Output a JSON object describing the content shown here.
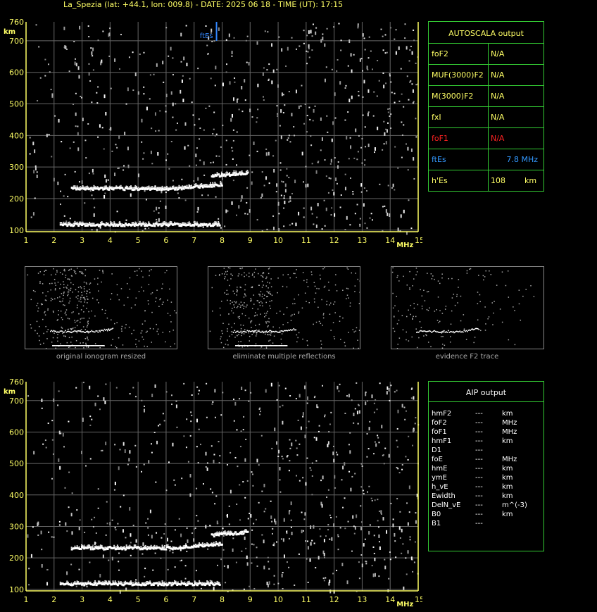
{
  "title": "La_Spezia (lat: +44.1, lon: 009.8) - DATE: 2025 06 18 - TIME (UT): 17:15",
  "colors": {
    "axis": "#ffff66",
    "grid": "#666666",
    "panel_border": "#33cc33",
    "fEs_marker": "#3388ff",
    "foF1": "#ff2222",
    "ftEs": "#3399ff",
    "trace": "#ffffff"
  },
  "chart_data": [
    {
      "type": "scatter",
      "name": "top-ionogram",
      "x_unit": "MHz",
      "y_unit": "km",
      "xlim": [
        1,
        15
      ],
      "ylim": [
        95,
        760
      ],
      "x_ticks": [
        1,
        2,
        3,
        4,
        5,
        6,
        7,
        8,
        9,
        10,
        11,
        12,
        13,
        14,
        15
      ],
      "y_ticks": [
        100,
        200,
        300,
        400,
        500,
        600,
        700,
        760
      ],
      "grid": true,
      "marker_label": "ftEs",
      "marker_x": 7.8,
      "traces": [
        {
          "x_start": 2.2,
          "x_end": 7.9,
          "y": 118
        },
        {
          "x_start": 2.6,
          "x_end": 8.0,
          "y": 232
        },
        {
          "x_start": 7.6,
          "x_end": 8.9,
          "y": 262
        }
      ]
    },
    {
      "type": "scatter",
      "name": "bottom-ionogram",
      "x_unit": "MHz",
      "y_unit": "km",
      "xlim": [
        1,
        15
      ],
      "ylim": [
        95,
        760
      ],
      "x_ticks": [
        1,
        2,
        3,
        4,
        5,
        6,
        7,
        8,
        9,
        10,
        11,
        12,
        13,
        14,
        15
      ],
      "y_ticks": [
        100,
        200,
        300,
        400,
        500,
        600,
        700,
        760
      ],
      "grid": true,
      "traces": [
        {
          "x_start": 2.2,
          "x_end": 7.9,
          "y": 118
        },
        {
          "x_start": 2.6,
          "x_end": 8.0,
          "y": 232
        },
        {
          "x_start": 7.6,
          "x_end": 8.9,
          "y": 262
        }
      ]
    }
  ],
  "autoscala": {
    "title": "AUTOSCALA output",
    "rows": [
      {
        "key": "foF2",
        "value": "N/A",
        "color": "#ffff66"
      },
      {
        "key": "MUF(3000)F2",
        "value": "N/A",
        "color": "#ffff66"
      },
      {
        "key": "M(3000)F2",
        "value": "N/A",
        "color": "#ffff66"
      },
      {
        "key": "fxI",
        "value": "N/A",
        "color": "#ffff66"
      },
      {
        "key": "foF1",
        "value": "N/A",
        "color": "#ff2222"
      },
      {
        "key": "ftEs",
        "value": "7.8  MHz",
        "color": "#3399ff"
      },
      {
        "key": "h'Es",
        "value": "108",
        "unit": "km",
        "color": "#ffff66"
      }
    ]
  },
  "aip": {
    "title": "AIP output",
    "rows": [
      {
        "k": "hmF2",
        "v": "---",
        "u": "km"
      },
      {
        "k": "foF2",
        "v": "---",
        "u": "MHz"
      },
      {
        "k": "foF1",
        "v": "---",
        "u": "MHz"
      },
      {
        "k": "hmF1",
        "v": "---",
        "u": "km"
      },
      {
        "k": "D1",
        "v": "---",
        "u": ""
      },
      {
        "k": "foE",
        "v": "---",
        "u": "MHz"
      },
      {
        "k": "hmE",
        "v": "---",
        "u": "km"
      },
      {
        "k": "ymE",
        "v": "---",
        "u": "km"
      },
      {
        "k": "h_vE",
        "v": "---",
        "u": "km"
      },
      {
        "k": "Ewidth",
        "v": "---",
        "u": "km"
      },
      {
        "k": "DelN_vE",
        "v": "---",
        "u": "m^(-3)"
      },
      {
        "k": "B0",
        "v": "---",
        "u": "km"
      },
      {
        "k": "B1",
        "v": "---",
        "u": ""
      }
    ]
  },
  "thumbnails": [
    {
      "caption": "original ionogram resized"
    },
    {
      "caption": "eliminate multiple reflections"
    },
    {
      "caption": "evidence F2 trace"
    }
  ],
  "axis_units": {
    "x": "MHz",
    "y": "km"
  }
}
